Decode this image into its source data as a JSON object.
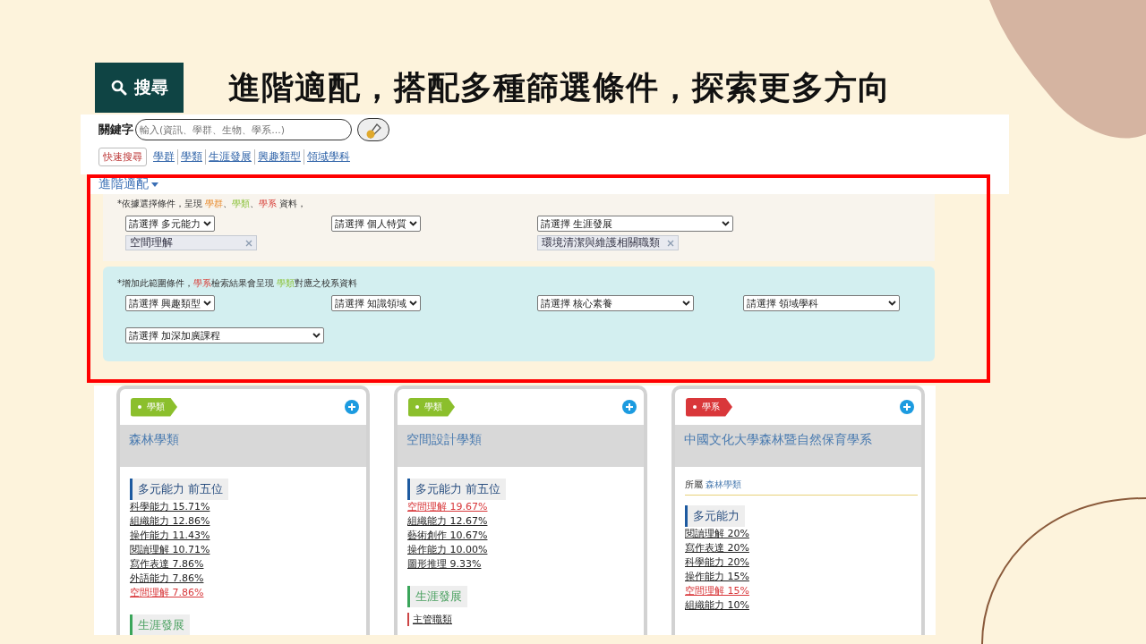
{
  "slide": {
    "search_button": "搜尋",
    "title": "進階適配，搭配多種篩選條件，探索更多方向"
  },
  "keyword": {
    "label": "關鍵字",
    "placeholder": "輸入(資訊、學群、生物、學系...)"
  },
  "quick_links": [
    {
      "label": "快速搜尋",
      "kind": "button"
    },
    {
      "label": "學群",
      "kind": "link"
    },
    {
      "label": "學類",
      "kind": "link"
    },
    {
      "label": "生涯發展",
      "kind": "link"
    },
    {
      "label": "興趣類型",
      "kind": "link"
    },
    {
      "label": "領域學科",
      "kind": "link"
    }
  ],
  "advanced": {
    "toggle": "進階適配",
    "sections": [
      {
        "kind": "basic",
        "note": [
          {
            "text": "*依據選擇條件，呈現 ",
            "kind": "plain"
          },
          {
            "text": "學群",
            "kind": "group"
          },
          {
            "text": "、",
            "kind": "plain"
          },
          {
            "text": "學類",
            "kind": "class"
          },
          {
            "text": "、",
            "kind": "plain"
          },
          {
            "text": "學系",
            "kind": "dept"
          },
          {
            "text": " 資料，",
            "kind": "plain"
          }
        ],
        "filters": [
          {
            "value": "請選擇 多元能力",
            "tag": "空間理解"
          },
          {
            "value": "請選擇 個人特質"
          },
          {
            "value": "請選擇 生涯發展",
            "tag": "環境清潔與維護相關職類"
          }
        ]
      },
      {
        "kind": "extra",
        "note": [
          {
            "text": "*增加此範圍條件，",
            "kind": "plain"
          },
          {
            "text": "學系",
            "kind": "dept"
          },
          {
            "text": "檢索結果會呈現 ",
            "kind": "plain"
          },
          {
            "text": "學類",
            "kind": "class"
          },
          {
            "text": "對應之校系資料",
            "kind": "plain"
          }
        ],
        "filters": [
          {
            "value": "請選擇 興趣類型"
          },
          {
            "value": "請選擇 知識領域"
          },
          {
            "value": "請選擇 核心素養"
          },
          {
            "value": "請選擇 領域學科"
          },
          {
            "value": "請選擇 加深加廣課程"
          }
        ]
      }
    ]
  },
  "cards": [
    {
      "tag": {
        "kind": "class",
        "label": "學類"
      },
      "title": "森林學類",
      "sections": [
        {
          "kind": "ability",
          "heading": "多元能力 前五位",
          "items": [
            {
              "text": "科學能力 15.71%",
              "highlighted": false
            },
            {
              "text": "組織能力 12.86%",
              "highlighted": false
            },
            {
              "text": "操作能力 11.43%",
              "highlighted": false
            },
            {
              "text": "閱讀理解 10.71%",
              "highlighted": false
            },
            {
              "text": "寫作表達 7.86%",
              "highlighted": false
            },
            {
              "text": "外語能力 7.86%",
              "highlighted": false
            },
            {
              "text": "空間理解 7.86%",
              "highlighted": true
            }
          ]
        },
        {
          "kind": "career",
          "heading": "生涯發展"
        }
      ]
    },
    {
      "tag": {
        "kind": "class",
        "label": "學類"
      },
      "title": "空間設計學類",
      "sections": [
        {
          "kind": "ability",
          "heading": "多元能力 前五位",
          "items": [
            {
              "text": "空間理解 19.67%",
              "highlighted": true
            },
            {
              "text": "組織能力 12.67%",
              "highlighted": false
            },
            {
              "text": "藝術創作 10.67%",
              "highlighted": false
            },
            {
              "text": "操作能力 10.00%",
              "highlighted": false
            },
            {
              "text": "圖形推理 9.33%",
              "highlighted": false
            }
          ]
        },
        {
          "kind": "career",
          "heading": "生涯發展",
          "subheading": "主管職類"
        }
      ]
    },
    {
      "tag": {
        "kind": "dept",
        "label": "學系"
      },
      "title": "中國文化大學森林暨自然保育學系",
      "belongs": {
        "label": "所屬",
        "value": "森林學類"
      },
      "sections": [
        {
          "kind": "ability",
          "heading": "多元能力",
          "items": [
            {
              "text": "閱讀理解 20%",
              "highlighted": false
            },
            {
              "text": "寫作表達 20%",
              "highlighted": false
            },
            {
              "text": "科學能力 20%",
              "highlighted": false
            },
            {
              "text": "操作能力 15%",
              "highlighted": false
            },
            {
              "text": "空間理解 15%",
              "highlighted": true
            },
            {
              "text": "組織能力 10%",
              "highlighted": false
            }
          ]
        }
      ]
    }
  ]
}
